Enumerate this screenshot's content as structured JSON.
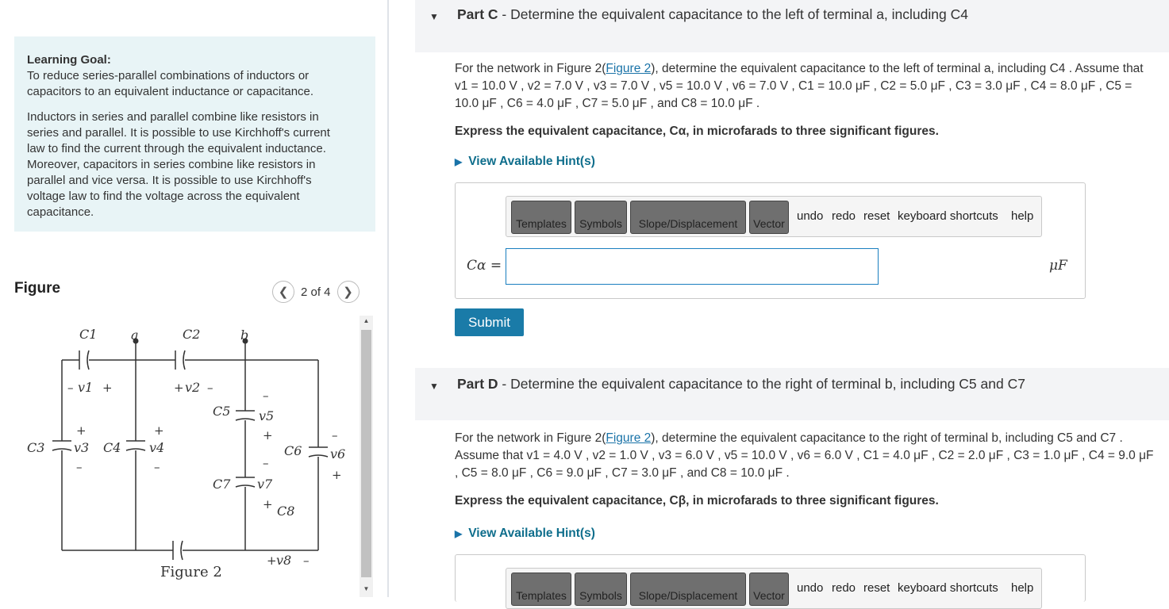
{
  "learning_goal": {
    "heading": "Learning Goal:",
    "para1": "To reduce series-parallel combinations of inductors or\ncapacitors to an equivalent inductance or capacitance.",
    "para2": "Inductors in series and parallel combine like resistors in\nseries and parallel.  It is possible to use Kirchhoff's current\nlaw to find the current through the equivalent inductance.\n Moreover, capacitors in series combine like resistors in\nparallel and vice versa.  It is possible to use Kirchhoff's\nvoltage law to find the voltage across the equivalent\ncapacitance."
  },
  "figure_panel": {
    "title": "Figure",
    "pager": "2 of 4",
    "prev_icon": "chevron-left-icon",
    "next_icon": "chevron-right-icon",
    "caption": "Figure 2",
    "labels": {
      "c1": "C1",
      "c2": "C2",
      "c3": "C3",
      "c4": "C4",
      "c5": "C5",
      "c6": "C6",
      "c7": "C7",
      "c8": "C8",
      "a": "a",
      "b": "b",
      "v1": "v1",
      "v2": "v2",
      "v3": "v3",
      "v4": "v4",
      "v5": "v5",
      "v6": "v6",
      "v7": "v7",
      "v8": "v8"
    }
  },
  "part_c": {
    "label": "Part C",
    "title": " - Determine the equivalent capacitance to the left of terminal a, including C4",
    "intro": "For the network in Figure 2(",
    "link": "Figure 2",
    "problem_rest": "), determine the equivalent capacitance to the left of terminal a, including C4 . Assume that v1 = 10.0 V , v2 = 7.0 V , v3 = 7.0 V , v5 = 10.0 V , v6 = 7.0 V , C1 = 10.0 μF , C2 = 5.0 μF , C3 = 3.0 μF , C4 = 8.0 μF , C5 = 10.0 μF , C6 = 4.0 μF , C7 = 5.0 μF , and C8 = 10.0 μF .",
    "express": "Express the equivalent capacitance, Cα, in microfarads to three significant figures.",
    "hint": "View Available Hint(s)",
    "variable": "Cα =",
    "unit": "μF",
    "submit": "Submit"
  },
  "part_d": {
    "label": "Part D",
    "title": " - Determine the equivalent capacitance to the right of terminal b, including C5 and C7",
    "intro": "For the network in Figure 2(",
    "link": "Figure 2",
    "problem_rest": "), determine the equivalent capacitance to the right of terminal b, including C5 and C7 . Assume that v1 = 4.0 V , v2 = 1.0 V , v3 = 6.0 V , v5 = 10.0 V , v6 = 6.0 V , C1 = 4.0 μF , C2 = 2.0 μF , C3 = 1.0 μF , C4 = 9.0 μF , C5 = 8.0 μF , C6 = 9.0 μF , C7 = 3.0 μF , and C8 = 10.0 μF .",
    "express": "Express the equivalent capacitance, Cβ, in microfarads to three significant figures.",
    "hint": "View Available Hint(s)"
  },
  "toolbar": {
    "templates": "Templates",
    "symbols": "Symbols",
    "slope": "Slope/Displacement",
    "vector": "Vector",
    "undo": "undo",
    "redo": "redo",
    "reset": "reset",
    "keyboard": "keyboard shortcuts",
    "help": "help"
  }
}
